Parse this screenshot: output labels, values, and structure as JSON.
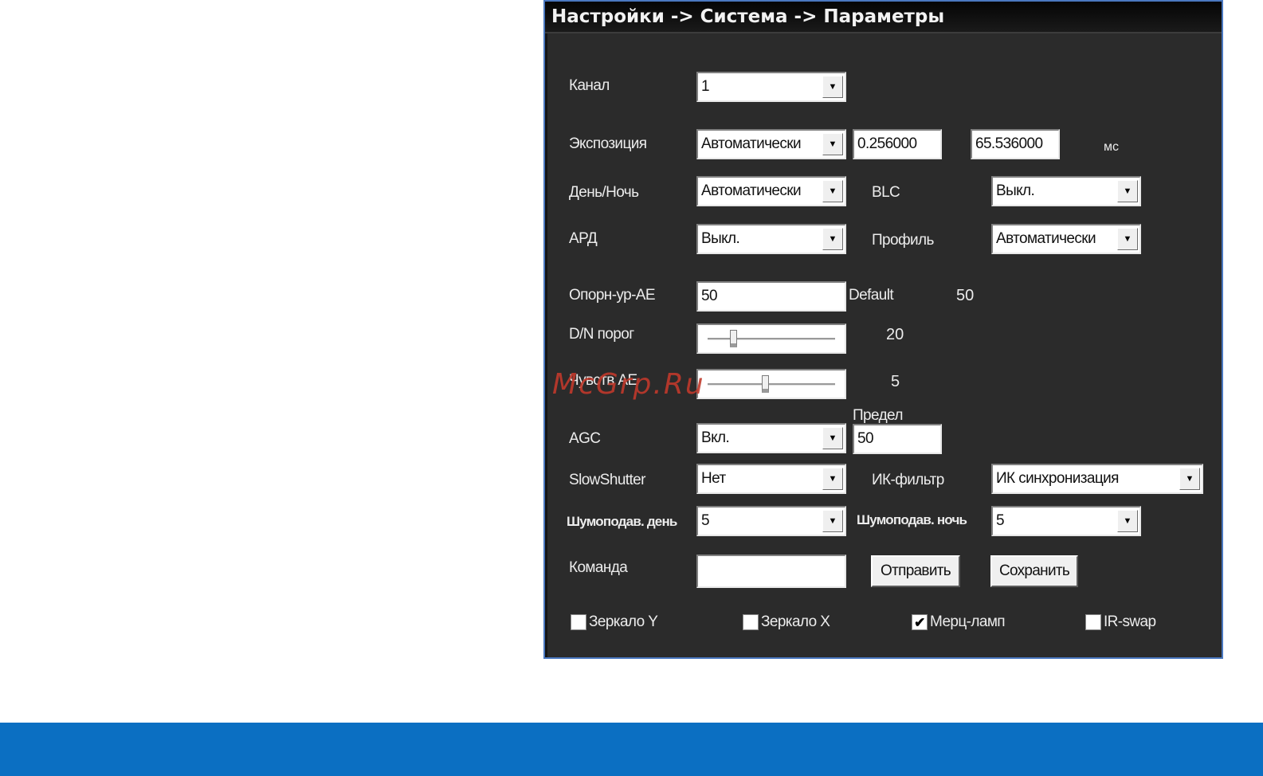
{
  "title": "Настройки -> Система -> Параметры",
  "watermark": "McGrp.Ru",
  "fields": {
    "channel": {
      "label": "Канал",
      "value": "1"
    },
    "exposure": {
      "label": "Экспозиция",
      "value": "Автоматически",
      "min": "0.256000",
      "max": "65.536000",
      "unit": "мс"
    },
    "daynight": {
      "label": "День/Ночь",
      "value": "Автоматически"
    },
    "blc": {
      "label": "BLC",
      "value": "Выкл."
    },
    "ard": {
      "label": "АРД",
      "value": "Выкл."
    },
    "profile": {
      "label": "Профиль",
      "value": "Автоматически"
    },
    "ae_ref": {
      "label": "Опорн-ур-AE",
      "value": "50",
      "default_label": "Default",
      "default_value": "50"
    },
    "dn_threshold": {
      "label": "D/N порог",
      "value": "20",
      "level": 0.2
    },
    "ae_sens": {
      "label": "Чувств AE",
      "value": "5",
      "level": 0.45
    },
    "agc": {
      "label": "AGC",
      "value": "Вкл.",
      "limit_label": "Предел",
      "limit_value": "50"
    },
    "slowshutter": {
      "label": "SlowShutter",
      "value": "Нет"
    },
    "ir_filter": {
      "label": "ИК-фильтр",
      "value": "ИК синхронизация"
    },
    "nr_day": {
      "label": "Шумоподав. день",
      "value": "5"
    },
    "nr_night": {
      "label": "Шумоподав. ночь",
      "value": "5"
    },
    "command": {
      "label": "Команда",
      "value": ""
    }
  },
  "buttons": {
    "send": "Отправить",
    "save": "Сохранить"
  },
  "checkboxes": {
    "mirror_y": {
      "label": "Зеркало Y",
      "checked": false
    },
    "mirror_x": {
      "label": "Зеркало X",
      "checked": false
    },
    "flicker": {
      "label": "Мерц-ламп",
      "checked": true
    },
    "ir_swap": {
      "label": "IR-swap",
      "checked": false
    }
  },
  "colors": {
    "panel_bg": "#2b2b2b",
    "panel_border": "#4a78c0",
    "footer": "#0b6fc2",
    "watermark": "#c0392b"
  }
}
